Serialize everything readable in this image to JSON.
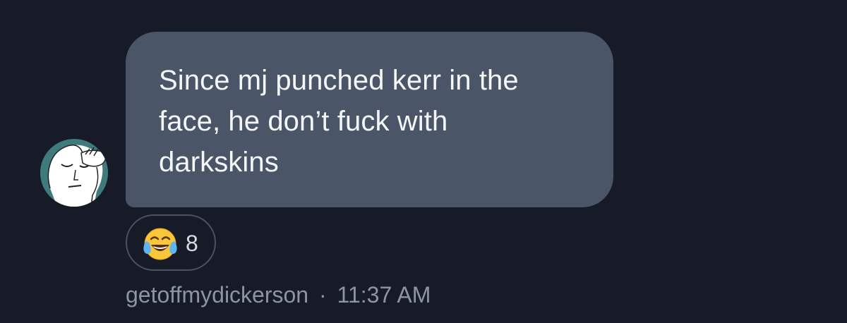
{
  "message": {
    "text": "Since mj punched kerr in the\nface, he don’t fuck with\ndarkskins",
    "bubble_color": "#4a5567"
  },
  "reaction": {
    "emoji_icon": "face-with-tears-of-joy-icon",
    "count": "8"
  },
  "meta": {
    "username": "getoffmydickerson",
    "separator": "·",
    "time": "11:37 AM"
  },
  "avatar": {
    "icon": "meme-face-avatar",
    "color": "#3f7a7c"
  },
  "colors": {
    "background": "#161b27",
    "text": "#f4f5f7",
    "meta_text": "#8c95a4"
  }
}
